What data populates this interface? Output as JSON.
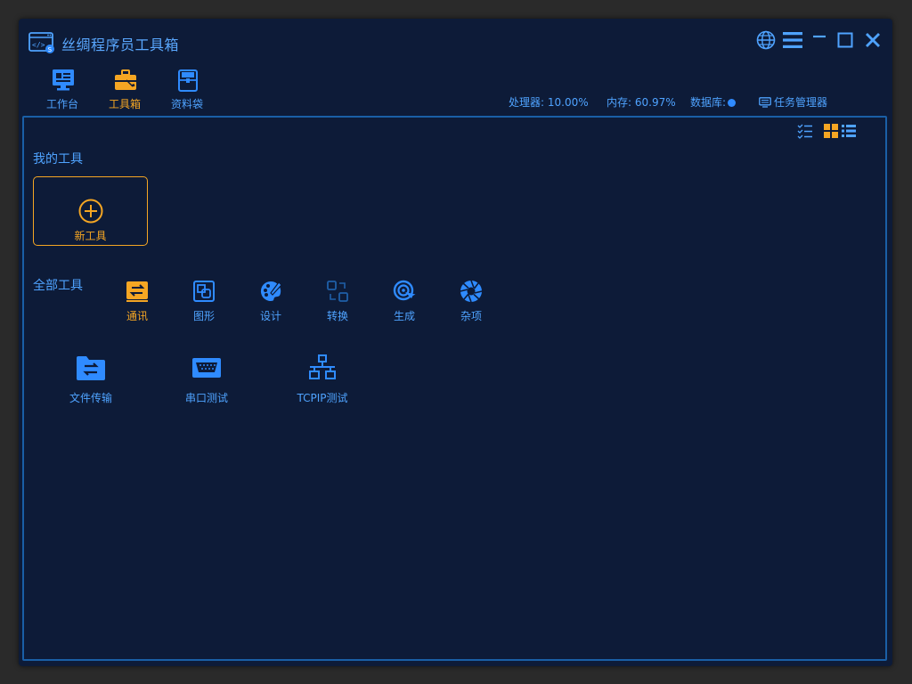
{
  "app": {
    "title": "丝绸程序员工具箱"
  },
  "colors": {
    "accent": "#f5a623",
    "primary": "#4fa3ff",
    "background": "#0d1b38",
    "border": "#1a5fa6"
  },
  "title_controls": [
    {
      "name": "language-globe-icon"
    },
    {
      "name": "menu-icon"
    },
    {
      "name": "minimize-icon"
    },
    {
      "name": "maximize-icon"
    },
    {
      "name": "close-icon"
    }
  ],
  "nav": {
    "items": [
      {
        "label": "工作台",
        "icon": "workbench-monitor-icon",
        "active": false
      },
      {
        "label": "工具箱",
        "icon": "toolbox-icon",
        "active": true
      },
      {
        "label": "资料袋",
        "icon": "document-bag-icon",
        "active": false
      }
    ]
  },
  "status": {
    "cpu": "处理器: 10.00%",
    "memory": "内存: 60.97%",
    "database": "数据库:",
    "task_manager": "任务管理器"
  },
  "view_toggle": {
    "options": [
      "checklist-view-icon",
      "grid-view-icon",
      "list-view-icon"
    ],
    "selected": "grid-view-icon"
  },
  "my_tools": {
    "title": "我的工具",
    "new_tool_label": "新工具"
  },
  "all_tools": {
    "title": "全部工具",
    "categories": [
      {
        "label": "通讯",
        "icon": "communication-swap-icon",
        "active": true
      },
      {
        "label": "图形",
        "icon": "graphics-icon",
        "active": false
      },
      {
        "label": "设计",
        "icon": "design-palette-icon",
        "active": false
      },
      {
        "label": "转换",
        "icon": "convert-icon",
        "active": false
      },
      {
        "label": "生成",
        "icon": "generate-target-icon",
        "active": false
      },
      {
        "label": "杂项",
        "icon": "misc-aperture-icon",
        "active": false
      }
    ],
    "tools": [
      {
        "label": "文件传输",
        "icon": "file-transfer-folder-icon"
      },
      {
        "label": "串口测试",
        "icon": "serial-port-icon"
      },
      {
        "label": "TCPIP测试",
        "icon": "network-topology-icon"
      }
    ]
  }
}
